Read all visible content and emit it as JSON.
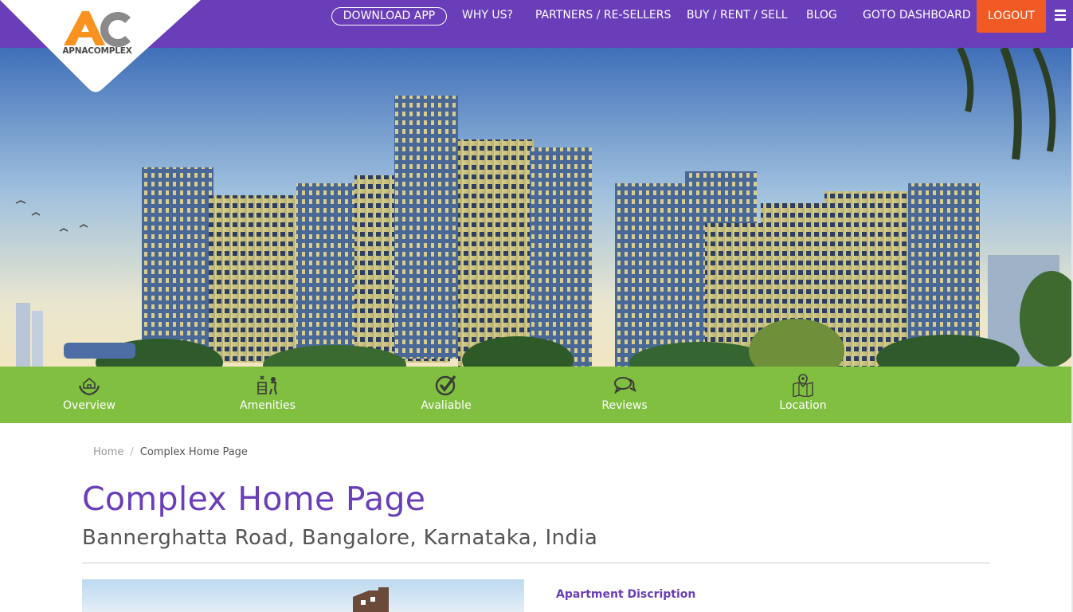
{
  "brand": {
    "name": "APNACOMPLEX"
  },
  "nav": {
    "download_app": "DOWNLOAD APP",
    "why_us": "WHY US?",
    "partners": "PARTNERS / RE-SELLERS",
    "buy_rent_sell": "BUY / RENT / SELL",
    "blog": "BLOG",
    "dashboard": "GOTO DASHBOARD",
    "logout": "LOGOUT"
  },
  "tabs": [
    {
      "label": "Overview",
      "icon": "house-in-hands-icon"
    },
    {
      "label": "Amenities",
      "icon": "amenities-icon"
    },
    {
      "label": "Avaliable",
      "icon": "check-circle-icon"
    },
    {
      "label": "Reviews",
      "icon": "chat-bubbles-icon"
    },
    {
      "label": "Location",
      "icon": "map-pin-icon"
    }
  ],
  "breadcrumb": {
    "home": "Home",
    "separator": "/",
    "current": "Complex Home Page"
  },
  "page": {
    "title": "Complex Home Page",
    "subtitle": "Bannerghatta Road, Bangalore, Karnataka, India",
    "description_heading": "Apartment Discription"
  },
  "colors": {
    "primary": "#6a3eb8",
    "tabbar": "#80bf40",
    "logout": "#f15a24",
    "logo_orange": "#f7931e"
  }
}
